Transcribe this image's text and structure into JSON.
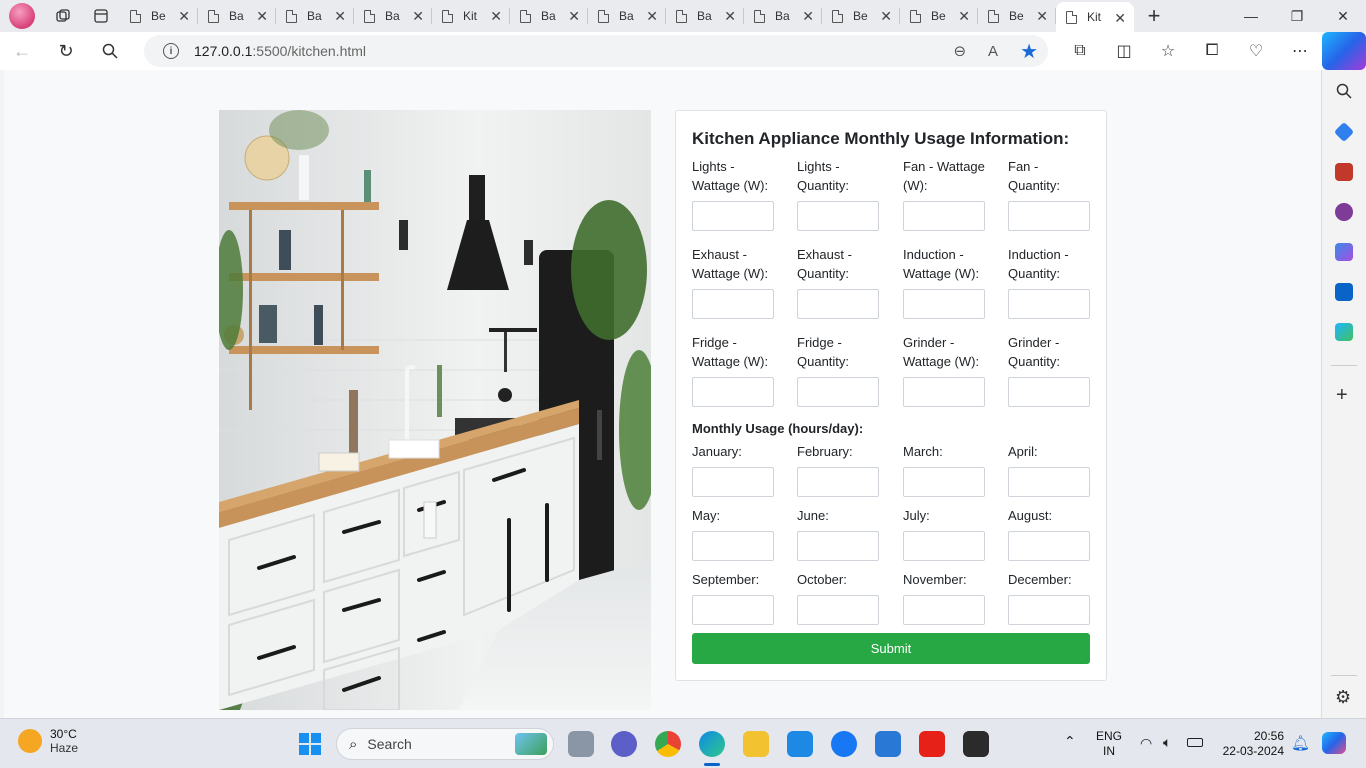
{
  "browser": {
    "tabs": [
      {
        "title": "Be"
      },
      {
        "title": "Ba"
      },
      {
        "title": "Ba"
      },
      {
        "title": "Ba"
      },
      {
        "title": "Kit"
      },
      {
        "title": "Ba"
      },
      {
        "title": "Ba"
      },
      {
        "title": "Ba"
      },
      {
        "title": "Ba"
      },
      {
        "title": "Be"
      },
      {
        "title": "Be"
      },
      {
        "title": "Be"
      },
      {
        "title": "Kit"
      }
    ],
    "active_tab_index": 12,
    "url_host": "127.0.0.1",
    "url_rest": ":5500/kitchen.html"
  },
  "page": {
    "form_title": "Kitchen Appliance Monthly Usage Information:",
    "appliance_fields": [
      {
        "label": "Lights - Wattage (W):"
      },
      {
        "label": "Lights - Quantity:"
      },
      {
        "label": "Fan - Wattage (W):"
      },
      {
        "label": "Fan - Quantity:"
      },
      {
        "label": "Exhaust - Wattage (W):"
      },
      {
        "label": "Exhaust - Quantity:"
      },
      {
        "label": "Induction - Wattage (W):"
      },
      {
        "label": "Induction - Quantity:"
      },
      {
        "label": "Fridge - Wattage (W):"
      },
      {
        "label": "Fridge - Quantity:"
      },
      {
        "label": "Grinder - Wattage (W):"
      },
      {
        "label": "Grinder - Quantity:"
      }
    ],
    "usage_heading": "Monthly Usage (hours/day):",
    "months": [
      {
        "label": "January:"
      },
      {
        "label": "February:"
      },
      {
        "label": "March:"
      },
      {
        "label": "April:"
      },
      {
        "label": "May:"
      },
      {
        "label": "June:"
      },
      {
        "label": "July:"
      },
      {
        "label": "August:"
      },
      {
        "label": "September:"
      },
      {
        "label": "October:"
      },
      {
        "label": "November:"
      },
      {
        "label": "December:"
      }
    ],
    "submit_label": "Submit"
  },
  "taskbar": {
    "weather_temp": "30°C",
    "weather_desc": "Haze",
    "search_label": "Search",
    "lang_1": "ENG",
    "lang_2": "IN",
    "time": "20:56",
    "date": "22-03-2024"
  },
  "colors": {
    "accent_green": "#28a745",
    "star_blue": "#1a6ad8"
  },
  "icons": [
    "profile-icon",
    "workspaces-icon",
    "tab-actions-icon",
    "page-icon",
    "close-icon",
    "new-tab-icon",
    "minimize-icon",
    "restore-icon",
    "close-window-icon",
    "back-icon",
    "refresh-icon",
    "search-icon",
    "info-icon",
    "zoom-icon",
    "read-aloud-icon",
    "favorite-star-icon",
    "extensions-icon",
    "split-screen-icon",
    "favorites-icon",
    "collections-icon",
    "performance-icon",
    "more-icon",
    "copilot-icon"
  ]
}
